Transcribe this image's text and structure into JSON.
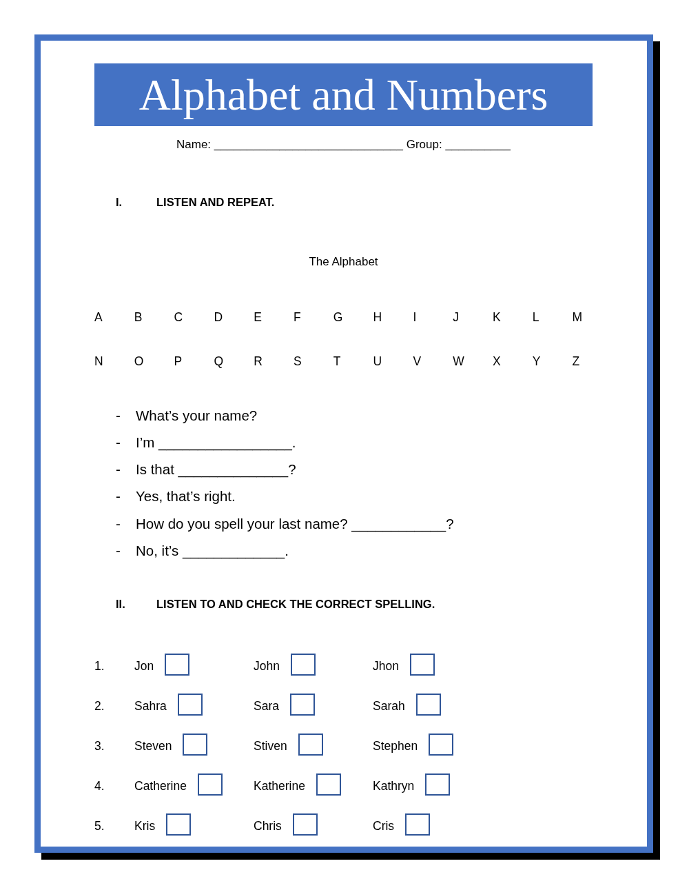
{
  "title": "Alphabet and Numbers",
  "name_line": "Name: _____________________________ Group: __________",
  "section_1": {
    "number": "I.",
    "heading": "LISTEN AND REPEAT."
  },
  "alphabet": {
    "caption": "The Alphabet",
    "rows": [
      [
        "A",
        "B",
        "C",
        "D",
        "E",
        "F",
        "G",
        "H",
        "I",
        "J",
        "K",
        "L",
        "M"
      ],
      [
        "N",
        "O",
        "P",
        "Q",
        "R",
        "S",
        "T",
        "U",
        "V",
        "W",
        "X",
        "Y",
        "Z"
      ]
    ]
  },
  "dialogue": [
    {
      "dash": "-",
      "text": "What’s your name?"
    },
    {
      "dash": "-",
      "text": "I’m _________________."
    },
    {
      "dash": "-",
      "text": "Is that ______________?"
    },
    {
      "dash": "-",
      "text": "Yes, that’s right."
    },
    {
      "dash": "-",
      "text": "How do you spell your last name? ____________?"
    },
    {
      "dash": "-",
      "text": "No, it’s _____________."
    }
  ],
  "section_2": {
    "number": "II.",
    "heading": "LISTEN TO AND CHECK THE CORRECT SPELLING."
  },
  "spelling": [
    {
      "number": "1.",
      "options": [
        {
          "word": "Jon",
          "checked": false
        },
        {
          "word": "John",
          "checked": false
        },
        {
          "word": "Jhon",
          "checked": false
        }
      ]
    },
    {
      "number": "2.",
      "options": [
        {
          "word": "Sahra",
          "checked": false
        },
        {
          "word": "Sara",
          "checked": false
        },
        {
          "word": "Sarah",
          "checked": false
        }
      ]
    },
    {
      "number": "3.",
      "options": [
        {
          "word": "Steven",
          "checked": false
        },
        {
          "word": "Stiven",
          "checked": false
        },
        {
          "word": "Stephen",
          "checked": false
        }
      ]
    },
    {
      "number": "4.",
      "options": [
        {
          "word": "Catherine",
          "checked": false
        },
        {
          "word": "Katherine",
          "checked": false
        },
        {
          "word": "Kathryn",
          "checked": false
        }
      ]
    },
    {
      "number": "5.",
      "options": [
        {
          "word": "Kris",
          "checked": false
        },
        {
          "word": "Chris",
          "checked": false
        },
        {
          "word": "Cris",
          "checked": false
        }
      ]
    }
  ]
}
